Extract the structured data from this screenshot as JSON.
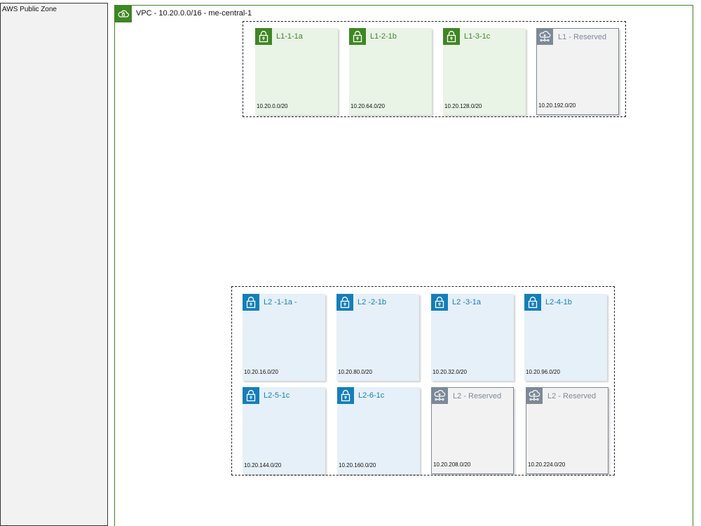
{
  "public_zone": {
    "label": "AWS Public Zone"
  },
  "vpc": {
    "title": "VPC - 10.20.0.0/16 - me-central-1",
    "icon": "cloud-icon",
    "color": "#3f8624"
  },
  "colors": {
    "green": "#3f8624",
    "blue": "#147eba",
    "gray": "#7d8998"
  },
  "l1_subnets": [
    {
      "name": "L1-1-1a",
      "cidr": "10.20.0.0/20",
      "style": "green",
      "icon": "lock-icon"
    },
    {
      "name": "L1-2-1b",
      "cidr": "10.20.64.0/20",
      "style": "green",
      "icon": "lock-icon"
    },
    {
      "name": "L1-3-1c",
      "cidr": "10.20.128.0/20",
      "style": "green",
      "icon": "lock-icon"
    },
    {
      "name": "L1 - Reserved",
      "cidr": "10.20.192.0/20",
      "style": "gray",
      "icon": "cloud-network-icon"
    }
  ],
  "l2_subnets": [
    {
      "name": "L2 -1-1a -",
      "cidr": "10.20.16.0/20",
      "style": "blue",
      "icon": "lock-icon"
    },
    {
      "name": "L2 -2-1b",
      "cidr": "10.20.80.0/20",
      "style": "blue",
      "icon": "lock-icon"
    },
    {
      "name": "L2 -3-1a",
      "cidr": "10.20.32.0/20",
      "style": "blue",
      "icon": "lock-icon"
    },
    {
      "name": "L2-4-1b",
      "cidr": "10.20.96.0/20",
      "style": "blue",
      "icon": "lock-icon"
    },
    {
      "name": "L2-5-1c",
      "cidr": "10.20.144.0/20",
      "style": "blue",
      "icon": "lock-icon"
    },
    {
      "name": "L2-6-1c",
      "cidr": "10.20.160.0/20",
      "style": "blue",
      "icon": "lock-icon"
    },
    {
      "name": "L2  - Reserved",
      "cidr": "10.20.208.0/20",
      "style": "gray",
      "icon": "cloud-network-icon"
    },
    {
      "name": "L2  - Reserved",
      "cidr": "10.20.224.0/20",
      "style": "gray",
      "icon": "cloud-network-icon"
    }
  ]
}
